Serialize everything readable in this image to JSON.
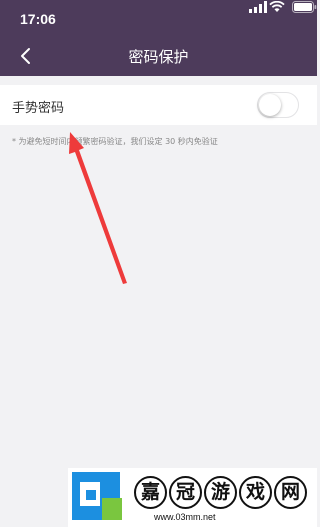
{
  "status_bar": {
    "time": "17:06"
  },
  "nav": {
    "title": "密码保护"
  },
  "settings": {
    "gesture_password": {
      "label": "手势密码",
      "enabled": false
    }
  },
  "hint": "* 为避免短时间内频繁密码验证，我们设定 30 秒内免验证",
  "watermark": {
    "chars": [
      "嘉",
      "冠",
      "游",
      "戏",
      "网"
    ],
    "url": "www.03mm.net"
  },
  "colors": {
    "header": "#4d3b5b",
    "background": "#f2f2f4",
    "arrow": "#ee3b3b"
  },
  "icons": [
    "back-arrow-icon",
    "signal-icon",
    "wifi-icon",
    "battery-icon"
  ]
}
